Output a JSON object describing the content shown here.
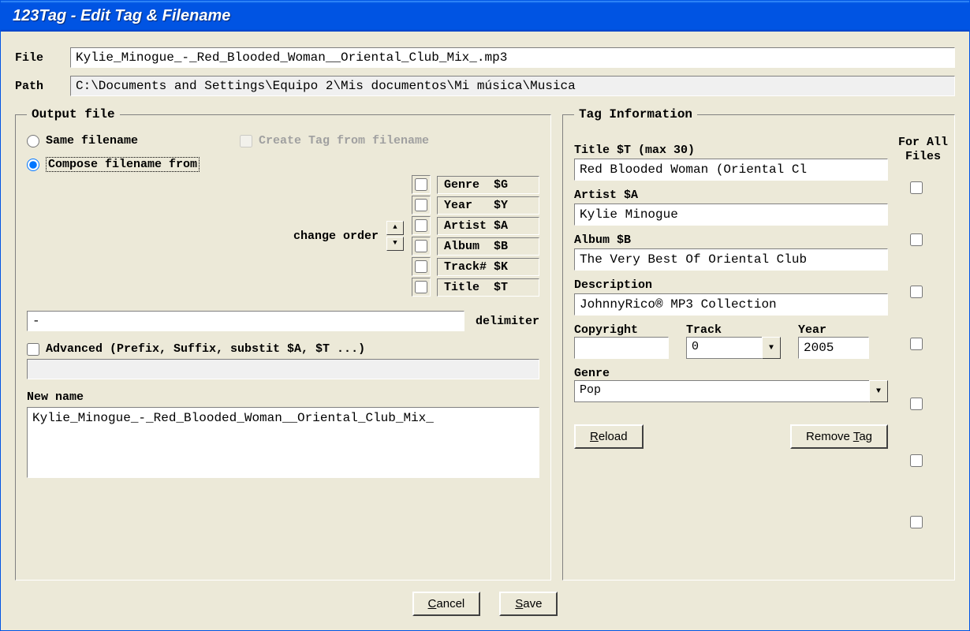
{
  "window": {
    "title": "123Tag - Edit Tag & Filename"
  },
  "file_row": {
    "label": "File",
    "value": "Kylie_Minogue_-_Red_Blooded_Woman__Oriental_Club_Mix_.mp3"
  },
  "path_row": {
    "label": "Path",
    "value": "C:\\Documents and Settings\\Equipo 2\\Mis documentos\\Mi música\\Musica"
  },
  "output": {
    "legend": "Output file",
    "same_filename": "Same filename",
    "create_tag": "Create Tag from filename",
    "compose_from": "Compose filename from",
    "change_order": "change order",
    "components": [
      {
        "label": "Genre",
        "code": "$G"
      },
      {
        "label": "Year",
        "code": "$Y"
      },
      {
        "label": "Artist",
        "code": "$A"
      },
      {
        "label": "Album",
        "code": "$B"
      },
      {
        "label": "Track#",
        "code": "$K"
      },
      {
        "label": "Title",
        "code": "$T"
      }
    ],
    "delimiter_label": "delimiter",
    "delimiter_value": "-",
    "advanced_label": "Advanced (Prefix, Suffix, substit $A, $T ...)",
    "advanced_value": "",
    "new_name_label": "New name",
    "new_name_value": "Kylie_Minogue_-_Red_Blooded_Woman__Oriental_Club_Mix_"
  },
  "taginfo": {
    "legend": "Tag Information",
    "for_all_header_l1": "For All",
    "for_all_header_l2": "Files",
    "title_label": "Title   $T  (max 30)",
    "title_value": "Red Blooded Woman (Oriental Cl",
    "artist_label": "Artist  $A",
    "artist_value": "Kylie Minogue",
    "album_label": "Album   $B",
    "album_value": "The Very Best Of Oriental Club",
    "desc_label": "Description",
    "desc_value": "JohnnyRico® MP3 Collection",
    "copyright_label": "Copyright",
    "copyright_value": "",
    "track_label": "Track",
    "track_value": "0",
    "year_label": "Year",
    "year_value": "2005",
    "genre_label": "Genre",
    "genre_value": "Pop",
    "reload": "Reload",
    "remove_tag": "Remove Tag"
  },
  "buttons": {
    "cancel": "Cancel",
    "save": "Save"
  }
}
